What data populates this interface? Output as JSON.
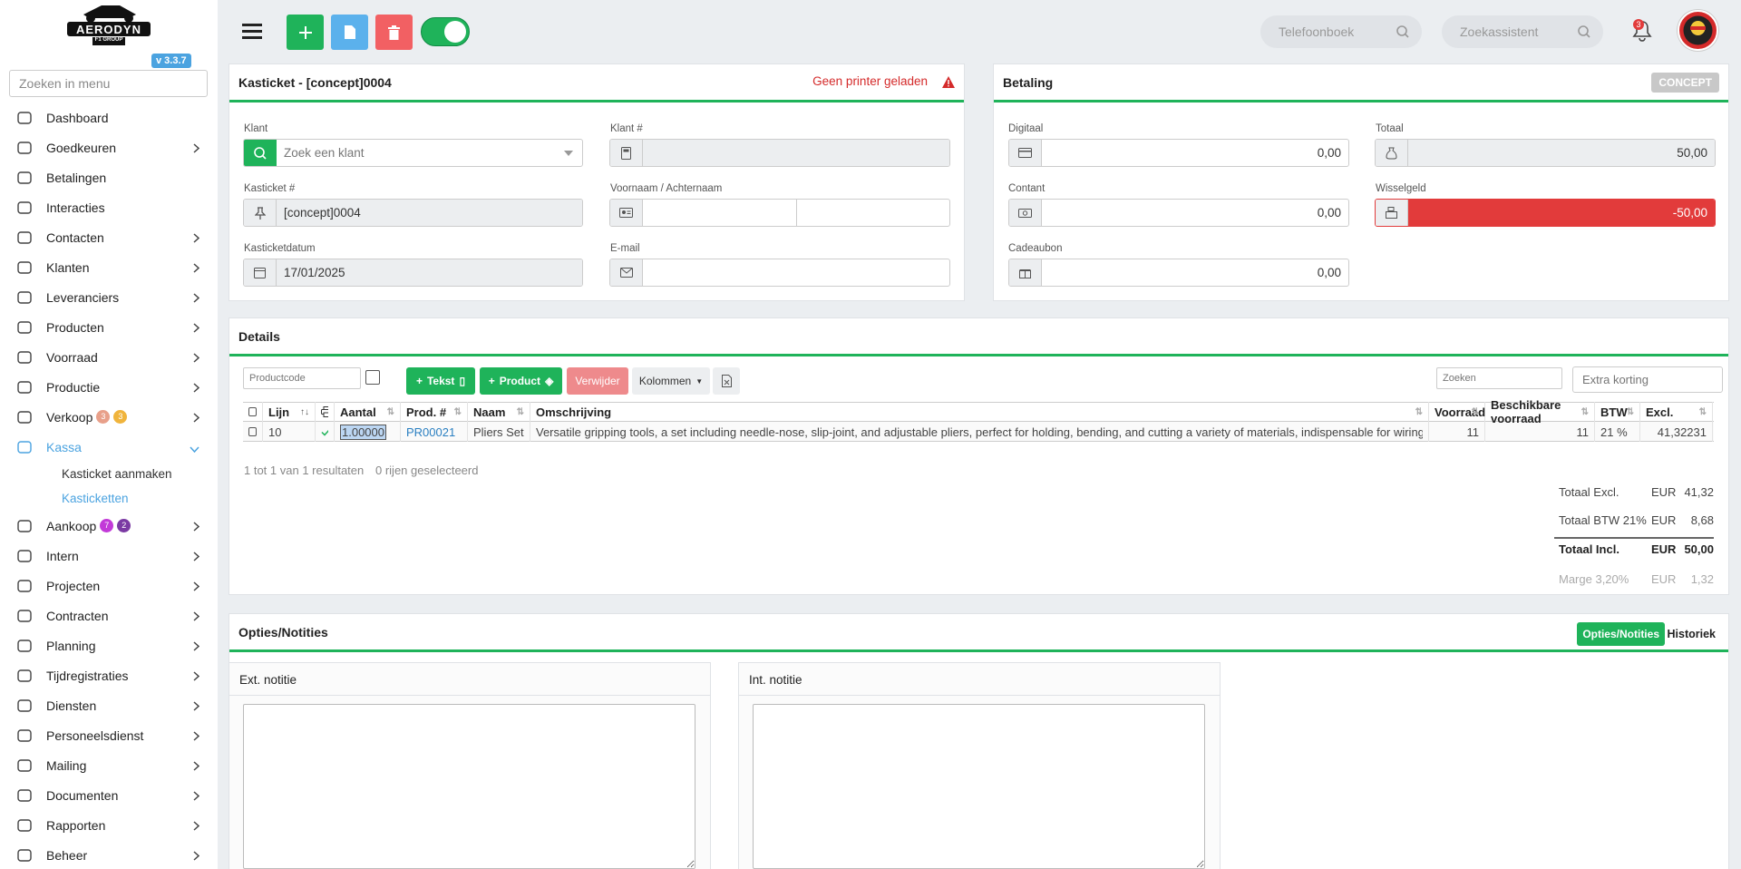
{
  "app": {
    "version": "v 3.3.7",
    "menu_search_placeholder": "Zoeken in menu",
    "logo_text": "AERODYN",
    "logo_sub": "F1 GROUP"
  },
  "nav": [
    {
      "label": "Dashboard",
      "icon": "gauge-icon"
    },
    {
      "label": "Goedkeuren",
      "icon": "user-check-icon"
    },
    {
      "label": "Betalingen",
      "icon": "credit-card-icon"
    },
    {
      "label": "Interacties",
      "icon": "chat-icon"
    },
    {
      "label": "Contacten",
      "icon": "contact-card-icon"
    },
    {
      "label": "Klanten",
      "icon": "user-icon"
    },
    {
      "label": "Leveranciers",
      "icon": "truck-icon"
    },
    {
      "label": "Producten",
      "icon": "box-icon"
    },
    {
      "label": "Voorraad",
      "icon": "boxes-icon"
    },
    {
      "label": "Productie",
      "icon": "gears-icon"
    },
    {
      "label": "Verkoop",
      "icon": "euro-icon",
      "badges": [
        "3",
        "3"
      ]
    },
    {
      "label": "Kassa",
      "icon": "basket-icon"
    },
    {
      "label": "Aankoop",
      "icon": "cart-icon",
      "badges": [
        "7",
        "2"
      ]
    },
    {
      "label": "Intern",
      "icon": "users-icon"
    },
    {
      "label": "Projecten",
      "icon": "project-icon"
    },
    {
      "label": "Contracten",
      "icon": "contract-icon"
    },
    {
      "label": "Planning",
      "icon": "calendar-icon"
    },
    {
      "label": "Tijdregistraties",
      "icon": "clock-icon"
    },
    {
      "label": "Diensten",
      "icon": "refresh-icon"
    },
    {
      "label": "Personeelsdienst",
      "icon": "staff-icon"
    },
    {
      "label": "Mailing",
      "icon": "send-icon"
    },
    {
      "label": "Documenten",
      "icon": "folder-icon"
    },
    {
      "label": "Rapporten",
      "icon": "chart-line-icon"
    },
    {
      "label": "Beheer",
      "icon": "settings-icon"
    }
  ],
  "kassa_sub": [
    "Kasticket aanmaken",
    "Kasticketten"
  ],
  "topbar": {
    "phonebook_placeholder": "Telefoonboek",
    "assistant_placeholder": "Zoekassistent",
    "notif_count": "3"
  },
  "ticket": {
    "title": "Kasticket - [concept]0004",
    "printer_warning": "Geen printer geladen",
    "klant_label": "Klant",
    "klant_placeholder": "Zoek een klant",
    "klantnr_label": "Klant #",
    "klantnr_value": "",
    "kasticket_label": "Kasticket #",
    "kasticket_value": "[concept]0004",
    "naam_label": "Voornaam / Achternaam",
    "datum_label": "Kasticketdatum",
    "datum_value": "17/01/2025",
    "email_label": "E-mail"
  },
  "betaling": {
    "title": "Betaling",
    "status": "CONCEPT",
    "digitaal_label": "Digitaal",
    "digitaal_value": "0,00",
    "totaal_label": "Totaal",
    "totaal_value": "50,00",
    "contant_label": "Contant",
    "contant_value": "0,00",
    "wissel_label": "Wisselgeld",
    "wissel_value": "-50,00",
    "cadeau_label": "Cadeaubon",
    "cadeau_value": "0,00"
  },
  "details": {
    "title": "Details",
    "productcode_placeholder": "Productcode",
    "btn_tekst": "Tekst",
    "btn_product": "Product",
    "btn_verwijder": "Verwijder",
    "btn_kolommen": "Kolommen",
    "search_placeholder": "Zoeken",
    "korting_placeholder": "Extra korting",
    "columns": [
      "Lijn",
      "Aantal",
      "Prod. #",
      "Naam",
      "Omschrijving",
      "Voorraad",
      "Beschikbare voorraad",
      "BTW",
      "Excl."
    ],
    "rows": [
      {
        "lijn": "10",
        "aantal": "1.00000",
        "prod": "PR00021",
        "naam": "Pliers Set",
        "omschrijving": "Versatile gripping tools, a set including needle-nose, slip-joint, and adjustable pliers, perfect for holding, bending, and cutting a variety of materials, indispensable for wiring and hose clamp adjustments",
        "voorraad": "11",
        "beschikbaar": "11",
        "btw": "21 %",
        "excl": "41,32231"
      }
    ],
    "result_info": "1 tot 1 van 1 resultaten",
    "selected_info": "0 rijen geselecteerd",
    "totals": [
      {
        "label": "Totaal Excl.",
        "cur": "EUR",
        "value": "41,32"
      },
      {
        "label": "Totaal BTW 21%",
        "cur": "EUR",
        "value": "8,68"
      },
      {
        "label": "Totaal Incl.",
        "cur": "EUR",
        "value": "50,00"
      },
      {
        "label": "Marge 3,20%",
        "cur": "EUR",
        "value": "1,32"
      }
    ]
  },
  "opties": {
    "title": "Opties/Notities",
    "tab_active": "Opties/Notities",
    "tab_other": "Historiek",
    "ext_label": "Ext. notitie",
    "int_label": "Int. notitie"
  },
  "colors": {
    "accent": "#1fb35a",
    "danger": "#e23b3b",
    "link": "#4ba3e0"
  }
}
